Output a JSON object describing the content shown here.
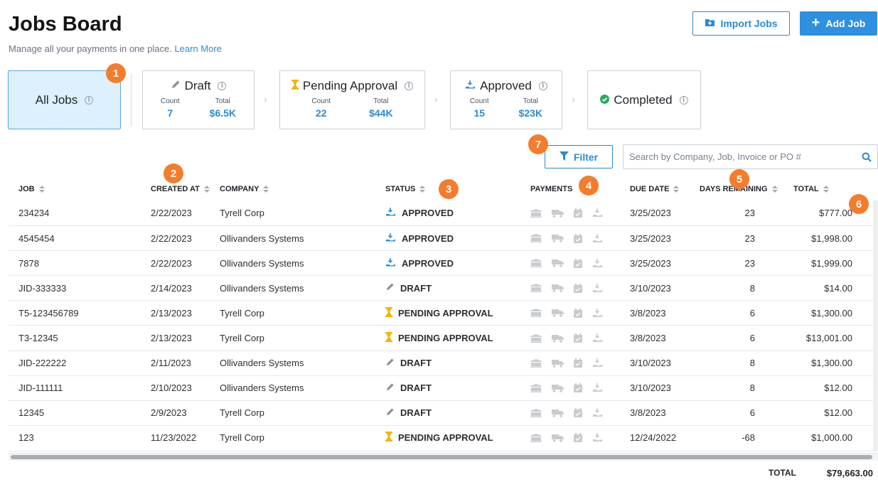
{
  "header": {
    "title": "Jobs Board",
    "subtitle": "Manage all your payments in one place.",
    "learn_more": "Learn More",
    "import_label": "Import Jobs",
    "add_label": "Add Job"
  },
  "cards": {
    "all": {
      "label": "All Jobs"
    },
    "draft": {
      "label": "Draft",
      "count_label": "Count",
      "count": "7",
      "total_label": "Total",
      "total": "$6.5K"
    },
    "pending": {
      "label": "Pending Approval",
      "count_label": "Count",
      "count": "22",
      "total_label": "Total",
      "total": "$44K"
    },
    "approved": {
      "label": "Approved",
      "count_label": "Count",
      "count": "15",
      "total_label": "Total",
      "total": "$23K"
    },
    "completed": {
      "label": "Completed"
    }
  },
  "badges": [
    "1",
    "2",
    "3",
    "4",
    "5",
    "6",
    "7"
  ],
  "toolbar": {
    "filter_label": "Filter",
    "search_placeholder": "Search by Company, Job, Invoice or PO #"
  },
  "columns": {
    "job": "JOB",
    "created": "CREATED AT",
    "company": "COMPANY",
    "status": "STATUS",
    "payments": "PAYMENTS",
    "due": "DUE DATE",
    "days": "DAYS REMAINING",
    "total": "TOTAL"
  },
  "rows": [
    {
      "job": "234234",
      "created": "2/22/2023",
      "company": "Tyrell Corp",
      "status": "APPROVED",
      "status_icon": "approved-hand-icon",
      "due": "3/25/2023",
      "days": "23",
      "total": "$777.00"
    },
    {
      "job": "4545454",
      "created": "2/22/2023",
      "company": "Ollivanders Systems",
      "status": "APPROVED",
      "status_icon": "approved-hand-icon",
      "due": "3/25/2023",
      "days": "23",
      "total": "$1,998.00"
    },
    {
      "job": "7878",
      "created": "2/22/2023",
      "company": "Ollivanders Systems",
      "status": "APPROVED",
      "status_icon": "approved-hand-icon",
      "due": "3/25/2023",
      "days": "23",
      "total": "$1,999.00"
    },
    {
      "job": "JID-333333",
      "created": "2/14/2023",
      "company": "Ollivanders Systems",
      "status": "DRAFT",
      "status_icon": "pencil-icon",
      "due": "3/10/2023",
      "days": "8",
      "total": "$14.00"
    },
    {
      "job": "T5-123456789",
      "created": "2/13/2023",
      "company": "Tyrell Corp",
      "status": "PENDING APPROVAL",
      "status_icon": "hourglass-icon",
      "due": "3/8/2023",
      "days": "6",
      "total": "$1,300.00"
    },
    {
      "job": "T3-12345",
      "created": "2/13/2023",
      "company": "Tyrell Corp",
      "status": "PENDING APPROVAL",
      "status_icon": "hourglass-icon",
      "due": "3/8/2023",
      "days": "6",
      "total": "$13,001.00"
    },
    {
      "job": "JID-222222",
      "created": "2/11/2023",
      "company": "Ollivanders Systems",
      "status": "DRAFT",
      "status_icon": "pencil-icon",
      "due": "3/10/2023",
      "days": "8",
      "total": "$1,300.00"
    },
    {
      "job": "JID-111111",
      "created": "2/10/2023",
      "company": "Ollivanders Systems",
      "status": "DRAFT",
      "status_icon": "pencil-icon",
      "due": "3/10/2023",
      "days": "8",
      "total": "$12.00"
    },
    {
      "job": "12345",
      "created": "2/9/2023",
      "company": "Tyrell Corp",
      "status": "DRAFT",
      "status_icon": "pencil-icon",
      "due": "3/8/2023",
      "days": "6",
      "total": "$12.00"
    },
    {
      "job": "123",
      "created": "11/23/2022",
      "company": "Tyrell Corp",
      "status": "PENDING APPROVAL",
      "status_icon": "hourglass-icon",
      "due": "12/24/2022",
      "days": "-68",
      "total": "$1,000.00"
    }
  ],
  "payment_icons": [
    "bank-icon",
    "truck-icon",
    "calendar-check-icon",
    "hand-payment-icon"
  ],
  "footer": {
    "total_label": "TOTAL",
    "total_value": "$79,663.00"
  },
  "colors": {
    "accent": "#2a8ad6",
    "badge": "#f47c2c",
    "pending": "#f2b705",
    "active_card": "#dcf0fd"
  }
}
